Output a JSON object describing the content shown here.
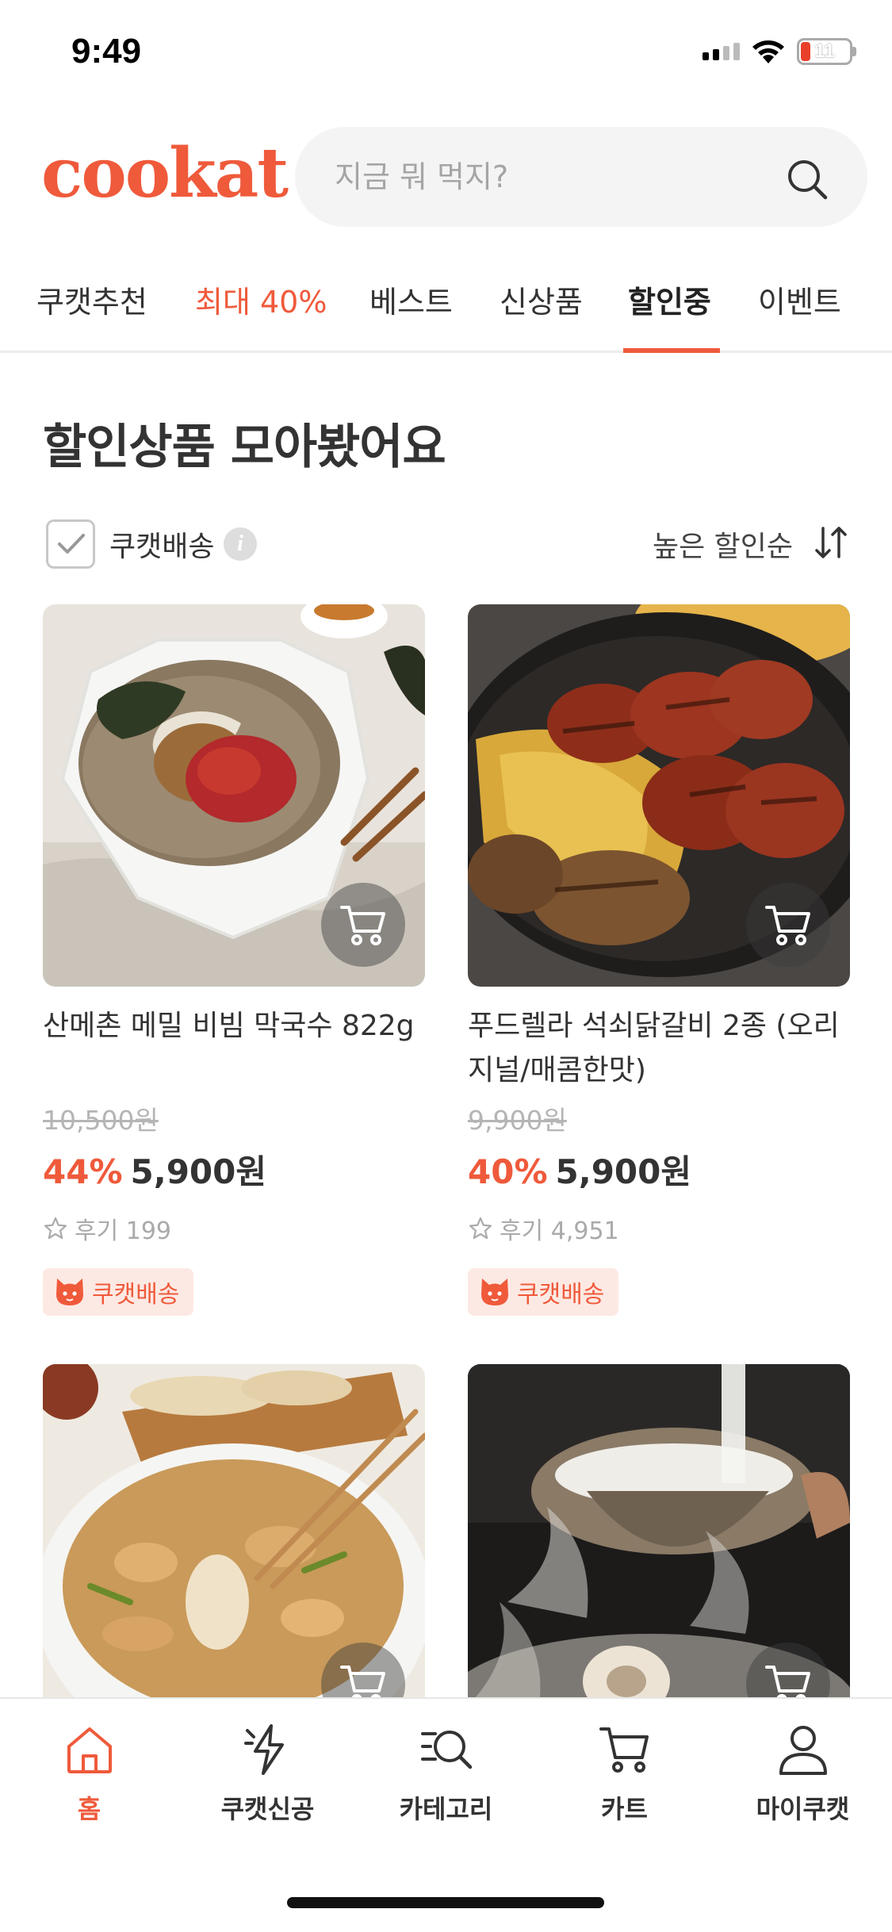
{
  "status_bar": {
    "time": "9:49",
    "battery": "11"
  },
  "header": {
    "logo": "cookat",
    "search_placeholder": "지금 뭐 먹지?"
  },
  "tabs": [
    {
      "label": "쿠캣추천"
    },
    {
      "label": "최대 40%"
    },
    {
      "label": "베스트"
    },
    {
      "label": "신상품"
    },
    {
      "label": "할인중"
    },
    {
      "label": "이벤트"
    }
  ],
  "active_tab": "할인중",
  "section_title": "할인상품 모아봤어요",
  "filter": {
    "label": "쿠캣배송",
    "checked": true,
    "info_icon": "info-icon",
    "sort_label": "높은 할인순"
  },
  "products": [
    {
      "name": "산메촌 메밀 비빔 막국수 822g",
      "original_price": "10,500원",
      "discount": "44%",
      "price": "5,900원",
      "reviews": "후기 199",
      "badge": "쿠캣배송"
    },
    {
      "name": "푸드렐라 석쇠닭갈비 2종 (오리지널/매콤한맛)",
      "original_price": "9,900원",
      "discount": "40%",
      "price": "5,900원",
      "reviews": "후기 4,951",
      "badge": "쿠캣배송"
    },
    {
      "name": "",
      "original_price": "",
      "discount": "",
      "price": "",
      "reviews": "",
      "badge": ""
    },
    {
      "name": "",
      "original_price": "",
      "discount": "",
      "price": "",
      "reviews": "",
      "badge": ""
    }
  ],
  "bottom_nav": [
    {
      "label": "홈",
      "icon": "home-icon",
      "active": true
    },
    {
      "label": "쿠캣신공",
      "icon": "lightning-icon",
      "active": false
    },
    {
      "label": "카테고리",
      "icon": "category-search-icon",
      "active": false
    },
    {
      "label": "카트",
      "icon": "cart-icon",
      "active": false
    },
    {
      "label": "마이쿠캣",
      "icon": "user-icon",
      "active": false
    }
  ],
  "colors": {
    "accent": "#ef5a3b",
    "badge_bg": "#fde9e3",
    "text": "#333333"
  }
}
